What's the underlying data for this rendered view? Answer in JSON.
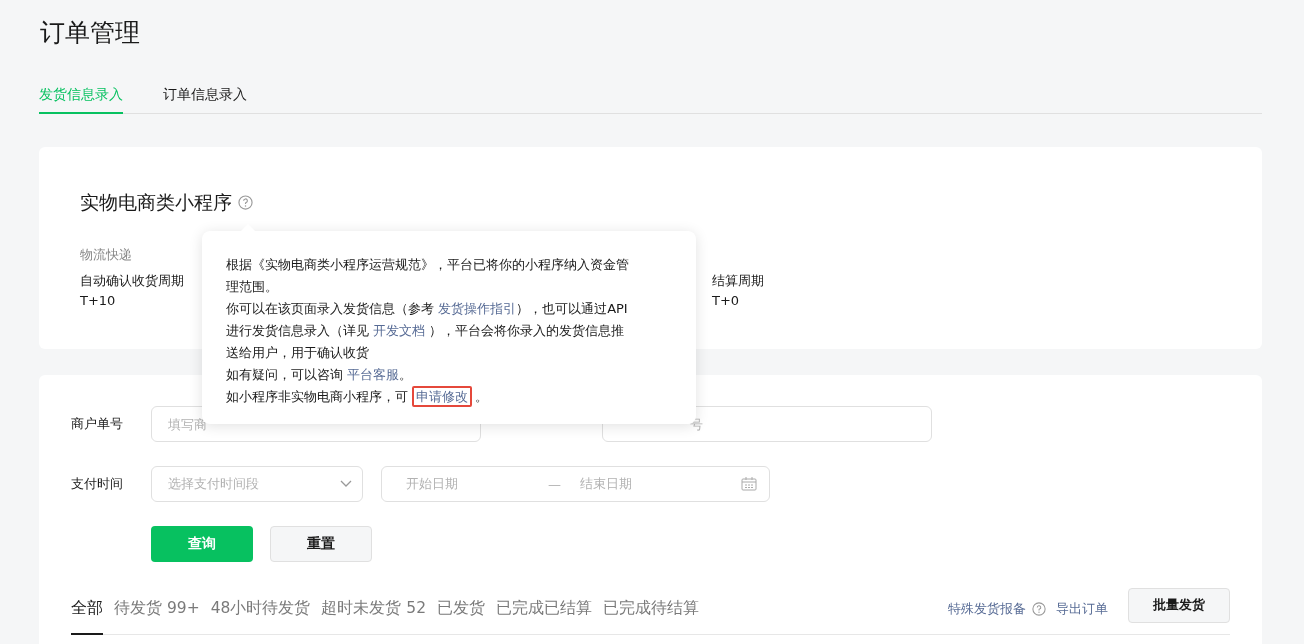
{
  "page_title": "订单管理",
  "tabs": [
    {
      "label": "发货信息录入",
      "selected": true
    },
    {
      "label": "订单信息录入",
      "selected": false
    }
  ],
  "mini_program": {
    "title": "实物电商类小程序",
    "category": "物流快递",
    "fields": [
      {
        "label": "自动确认收货周期",
        "value": "T+10"
      },
      {
        "label": "结算周期",
        "value": "T+0"
      }
    ]
  },
  "tooltip": {
    "paragraphs": [
      [
        {
          "kind": "text",
          "text": "根据《实物电商类小程序运营规范》，平台已将你的小程序纳入资金管理范围。"
        }
      ],
      [
        {
          "kind": "text",
          "text": "你可以在该页面录入发货信息（参考 "
        },
        {
          "kind": "link",
          "text": "发货操作指引"
        },
        {
          "kind": "text",
          "text": "），也可以通过API进行发货信息录入（详见 "
        },
        {
          "kind": "link",
          "text": "开发文档"
        },
        {
          "kind": "text",
          "text": " ），平台会将你录入的发货信息推送给用户，用于确认收货"
        }
      ],
      [
        {
          "kind": "text",
          "text": "如有疑问，可以咨询 "
        },
        {
          "kind": "link",
          "text": "平台客服"
        },
        {
          "kind": "text",
          "text": "。"
        }
      ],
      [
        {
          "kind": "text",
          "text": "如小程序非实物电商小程序，可 "
        },
        {
          "kind": "link",
          "text": "申请修改",
          "highlighted": true
        },
        {
          "kind": "text",
          "text": "。"
        }
      ]
    ]
  },
  "filters": {
    "row_1": {
      "label": "商户单号",
      "inputs": [
        {
          "placeholder": "填写商"
        },
        {
          "placeholder": "号"
        }
      ]
    },
    "row_2": {
      "label": "支付时间",
      "select": {
        "placeholder": "选择支付时间段"
      },
      "date_range": {
        "start": "开始日期",
        "separator": "—",
        "end": "结束日期"
      }
    },
    "buttons": [
      {
        "label": "查询",
        "kind": "primary"
      },
      {
        "label": "重置",
        "kind": "default"
      }
    ]
  },
  "status_tabs": [
    {
      "label": "全部",
      "selected": true
    },
    {
      "label": "待发货 99+",
      "selected": false
    },
    {
      "label": "48小时待发货",
      "selected": false
    },
    {
      "label": "超时未发货 52",
      "selected": false
    },
    {
      "label": "已发货",
      "selected": false
    },
    {
      "label": "已完成已结算",
      "selected": false
    },
    {
      "label": "已完成待结算",
      "selected": false
    }
  ],
  "actions": {
    "special_report": "特殊发货报备",
    "export": "导出订单",
    "batch_ship": "批量发货"
  }
}
